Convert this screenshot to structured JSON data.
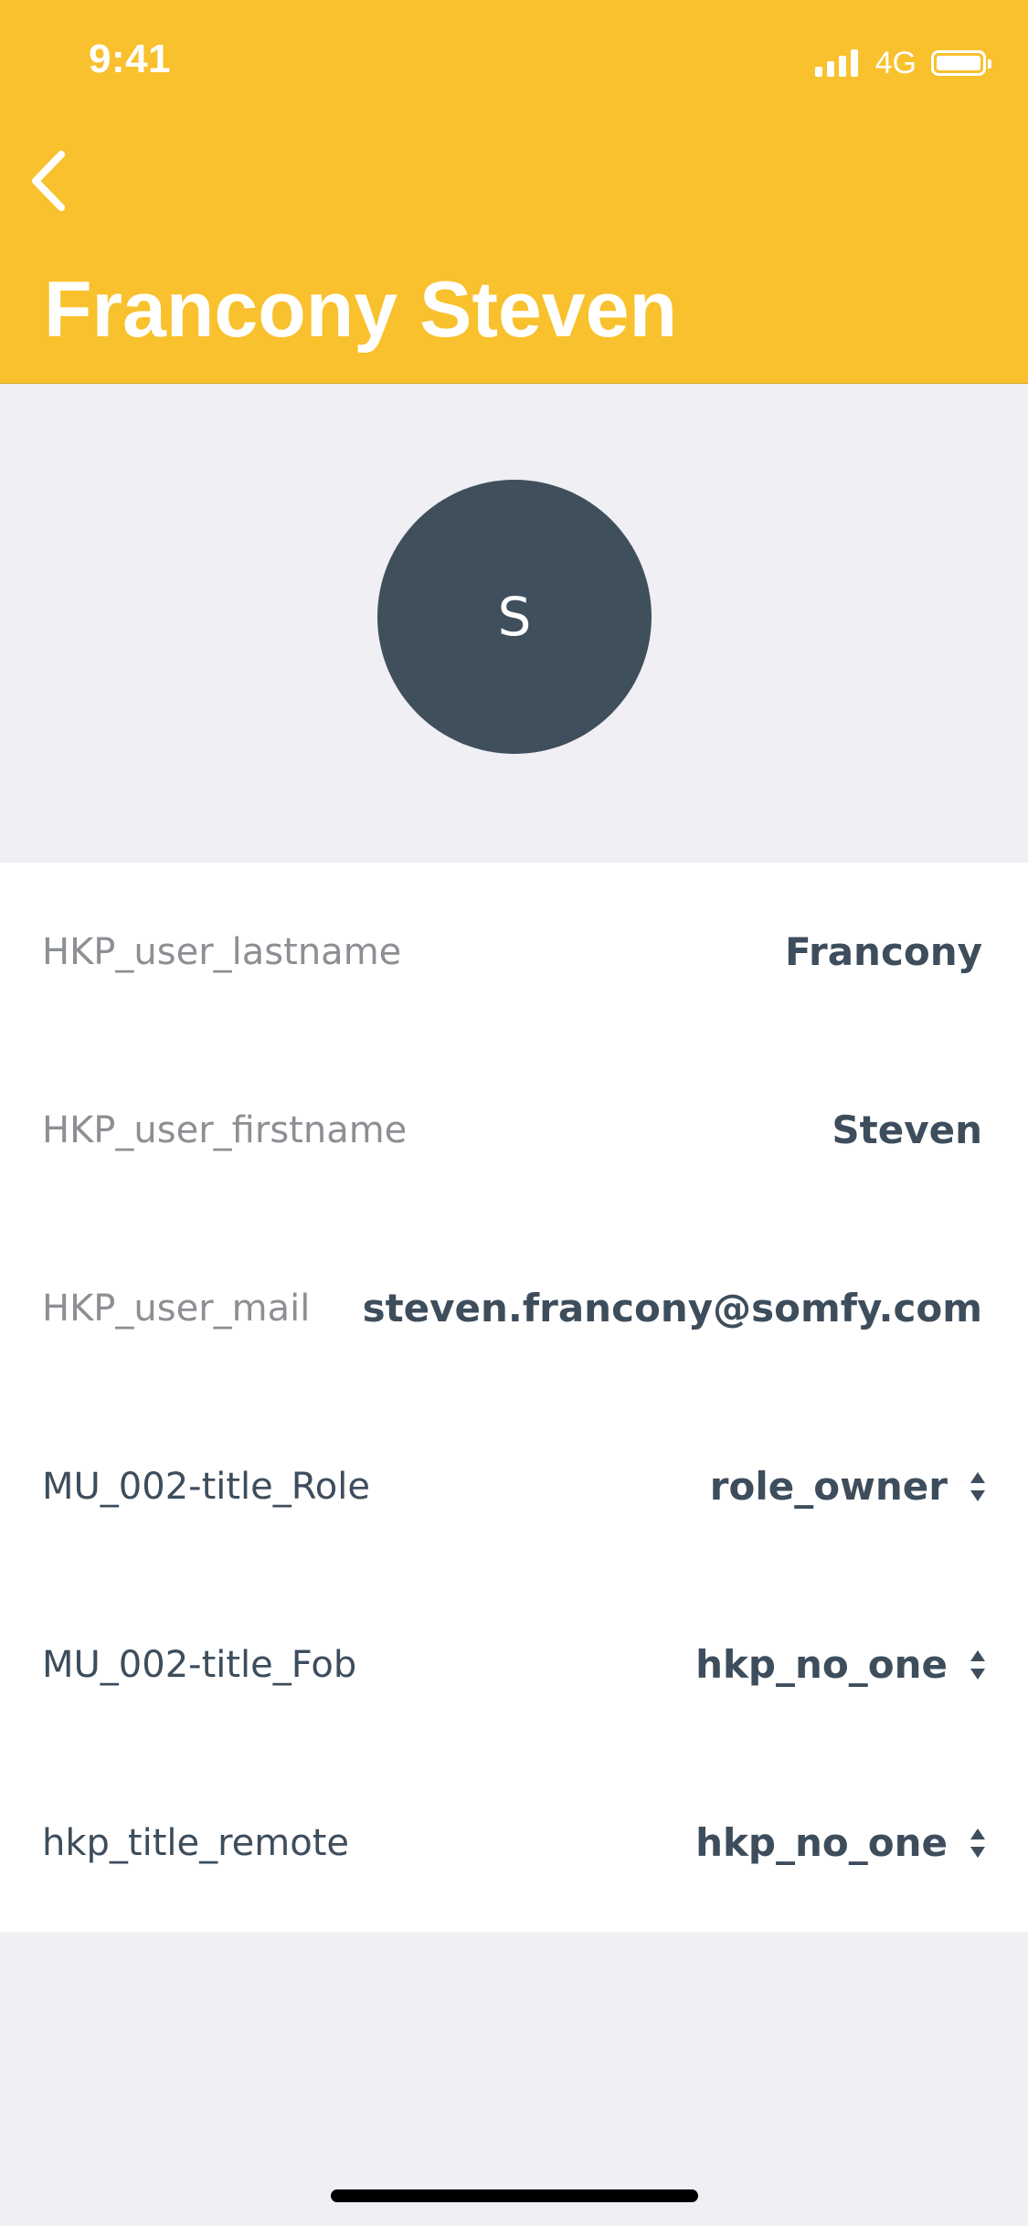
{
  "status_bar": {
    "time": "9:41",
    "network": "4G",
    "icons": [
      "signal-icon",
      "battery-icon"
    ]
  },
  "header": {
    "back_icon": "chevron-left-icon",
    "title": "Francony Steven",
    "background_color": "#f8c12d"
  },
  "avatar": {
    "initial": "S",
    "color": "#404f5c"
  },
  "fields": [
    {
      "label": "HKP_user_lastname",
      "value": "Francony"
    },
    {
      "label": "HKP_user_firstname",
      "value": "Steven"
    },
    {
      "label": "HKP_user_mail",
      "value": "steven.francony@somfy.com"
    },
    {
      "label": "MU_002-title_Role",
      "value": "role_owner",
      "icon": "sort-icon"
    },
    {
      "label": "MU_002-title_Fob",
      "value": "hkp_no_one",
      "icon": "sort-icon"
    },
    {
      "label": "hkp_title_remote",
      "value": "hkp_no_one",
      "icon": "sort-icon"
    }
  ]
}
